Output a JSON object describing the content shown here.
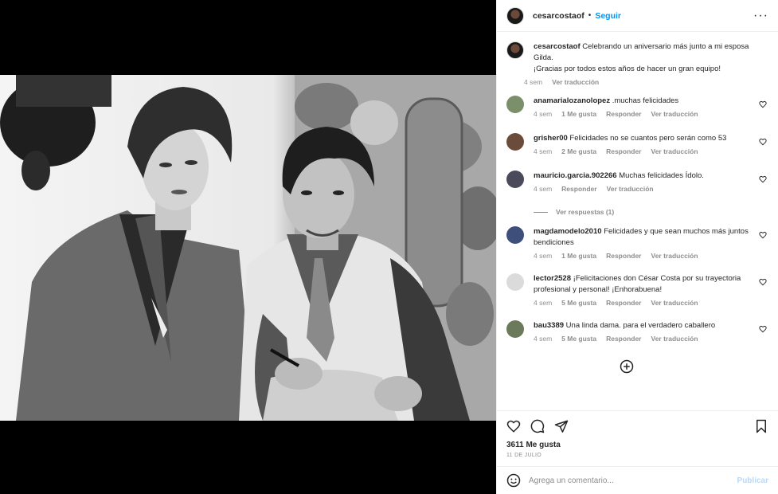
{
  "header": {
    "username": "cesarcostaof",
    "separator": "•",
    "follow_label": "Seguir",
    "more_label": "···"
  },
  "caption": {
    "username": "cesarcostaof",
    "text_line1": "Celebrando un aniversario más junto a mi esposa Gilda.",
    "text_line2": "¡Gracias por todos estos años de hacer un gran equipo!",
    "time": "4 sem",
    "translate": "Ver traducción"
  },
  "comments": [
    {
      "username": "anamarialozanolopez",
      "text": ".muchas felicidades",
      "time": "4 sem",
      "likes": "1 Me gusta",
      "reply": "Responder",
      "translate": "Ver traducción",
      "avatar_color": "#7a8f6a"
    },
    {
      "username": "grisher00",
      "text": "Felicidades no se cuantos pero serán como 53",
      "time": "4 sem",
      "likes": "2 Me gusta",
      "reply": "Responder",
      "translate": "Ver traducción",
      "avatar_color": "#6b4c3b"
    },
    {
      "username": "mauricio.garcia.902266",
      "text": "Muchas felicidades Ídolo.",
      "time": "4 sem",
      "likes": "",
      "reply": "Responder",
      "translate": "Ver traducción",
      "avatar_color": "#4a4a5a",
      "view_replies": "Ver respuestas (1)"
    },
    {
      "username": "magdamodelo2010",
      "text": "Felicidades y que sean muchos más juntos bendiciones",
      "time": "4 sem",
      "likes": "1 Me gusta",
      "reply": "Responder",
      "translate": "Ver traducción",
      "avatar_color": "#3d4f7a"
    },
    {
      "username": "lector2528",
      "text": "¡Felicitaciones don César Costa por su trayectoria profesional y personal! ¡Enhorabuena!",
      "time": "4 sem",
      "likes": "5 Me gusta",
      "reply": "Responder",
      "translate": "Ver traducción",
      "avatar_color": "#dbdbdb"
    },
    {
      "username": "bau3389",
      "text": "Una linda dama. para el verdadero caballero",
      "time": "4 sem",
      "likes": "5 Me gusta",
      "reply": "Responder",
      "translate": "Ver traducción",
      "avatar_color": "#6a7a5a"
    }
  ],
  "actions": {
    "likes_count": "3611 Me gusta",
    "date": "11 DE JULIO"
  },
  "add_comment": {
    "placeholder": "Agrega un comentario...",
    "post_label": "Publicar"
  },
  "colors": {
    "link_blue": "#0095f6",
    "muted": "#8e8e8e",
    "border": "#efefef",
    "post_disabled": "#b3dbff"
  },
  "icons": [
    "more-icon",
    "heart-icon",
    "comment-icon",
    "share-icon",
    "save-icon",
    "emoji-icon",
    "load-more-icon"
  ]
}
